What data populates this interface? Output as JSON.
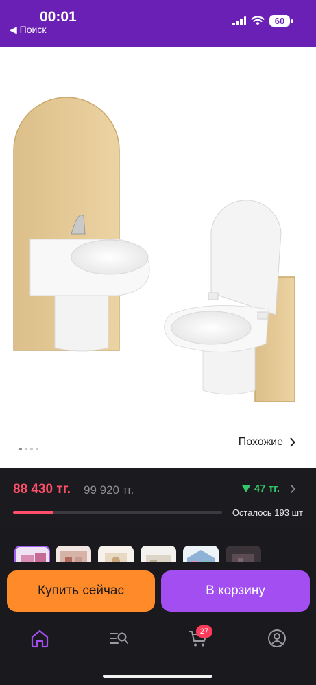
{
  "status_bar": {
    "time": "00:01",
    "back_label": "◀ Поиск",
    "battery": "60"
  },
  "product": {
    "image_dots": 4,
    "active_dot": 0,
    "similar_label": "Похожие"
  },
  "price": {
    "current": "88 430 тг.",
    "old": "99 920 тг.",
    "bonus": "47 тг.",
    "stock_text": "Осталось 193 шт",
    "stock_fill_percent": 19
  },
  "thumbnails": [
    "thumb-1",
    "thumb-2",
    "thumb-3",
    "thumb-4",
    "thumb-5",
    "thumb-6"
  ],
  "actions": {
    "buy_now": "Купить сейчас",
    "add_to_cart": "В корзину"
  },
  "tab_bar": {
    "cart_count": "27",
    "tabs": [
      "home-icon",
      "catalog-search-icon",
      "cart-icon",
      "profile-icon"
    ]
  },
  "colors": {
    "accent_purple": "#a34ef0",
    "status_purple": "#6a1fb5",
    "buy_orange": "#ff8a2a",
    "price_red": "#ff4f6a",
    "bonus_green": "#35c86a"
  }
}
